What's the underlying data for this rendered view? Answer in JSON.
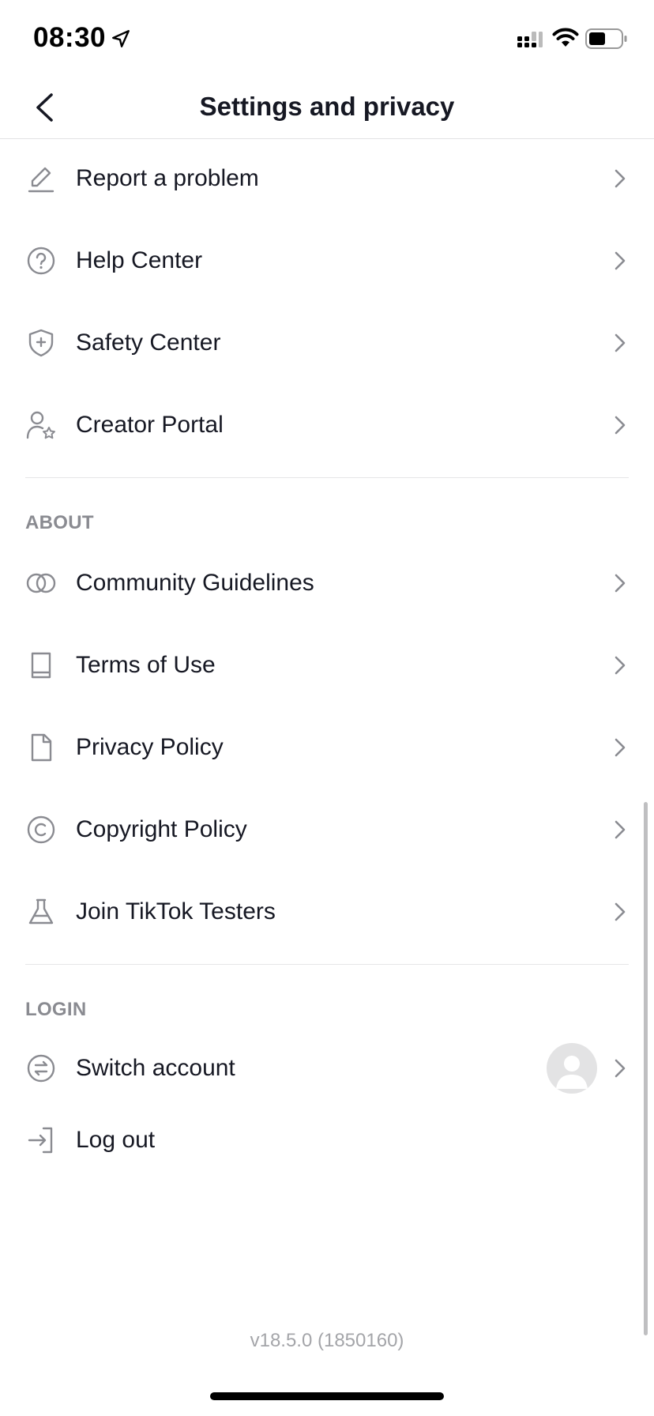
{
  "status_bar": {
    "time": "08:30"
  },
  "header": {
    "title": "Settings and privacy"
  },
  "support_items": [
    {
      "label": "Report a problem",
      "icon": "pencil-icon"
    },
    {
      "label": "Help Center",
      "icon": "question-circle-icon"
    },
    {
      "label": "Safety Center",
      "icon": "shield-plus-icon"
    },
    {
      "label": "Creator Portal",
      "icon": "person-star-icon"
    }
  ],
  "about": {
    "title": "ABOUT",
    "items": [
      {
        "label": "Community Guidelines",
        "icon": "interlocking-circles-icon"
      },
      {
        "label": "Terms of Use",
        "icon": "book-icon"
      },
      {
        "label": "Privacy Policy",
        "icon": "document-icon"
      },
      {
        "label": "Copyright Policy",
        "icon": "copyright-icon"
      },
      {
        "label": "Join TikTok Testers",
        "icon": "flask-icon"
      }
    ]
  },
  "login": {
    "title": "LOGIN",
    "items": [
      {
        "label": "Switch account",
        "icon": "switch-arrows-icon"
      },
      {
        "label": "Log out",
        "icon": "log-out-icon"
      }
    ]
  },
  "footer": {
    "version": "v18.5.0 (1850160)"
  },
  "colors": {
    "text": "#161823",
    "section_title": "#8a8b91",
    "icon": "#8a8b91",
    "chevron": "#8a8b91",
    "divider": "#e6e6e7"
  }
}
